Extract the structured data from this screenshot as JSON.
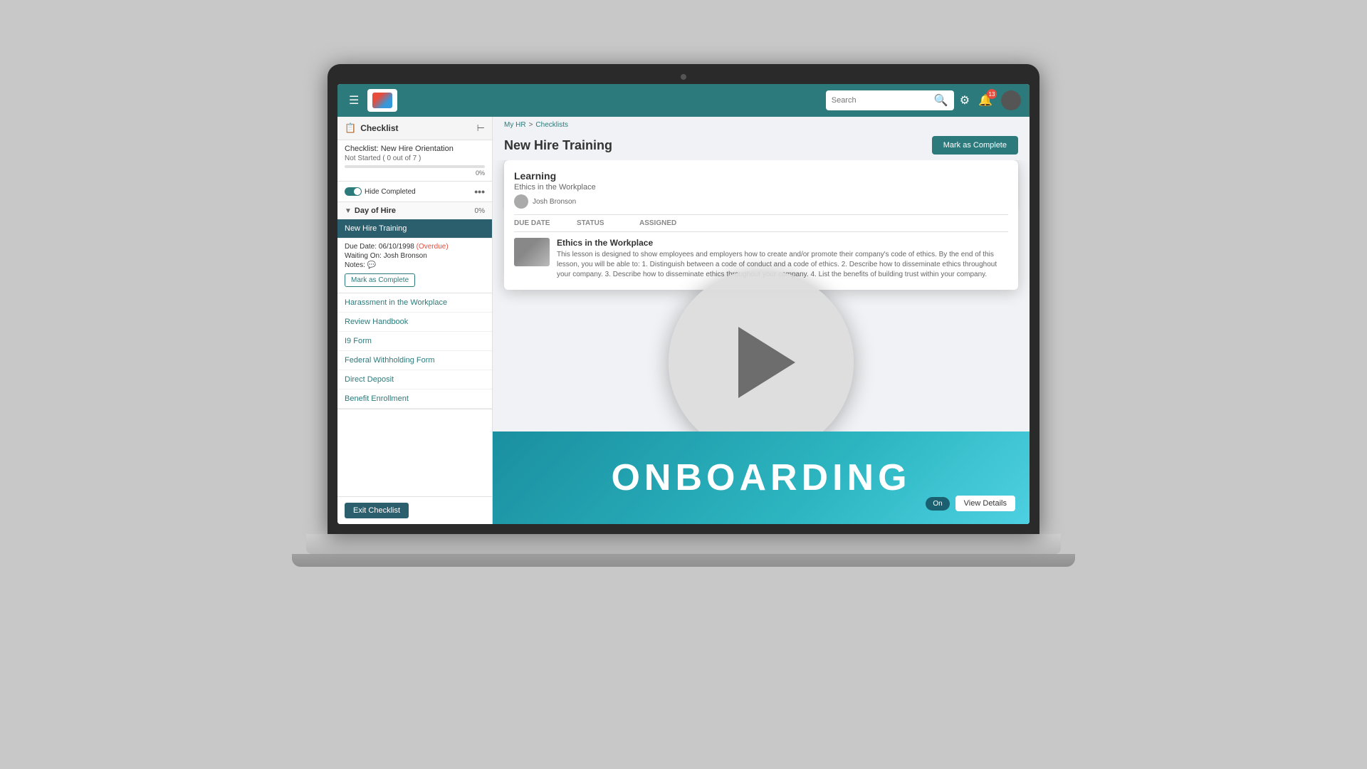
{
  "laptop": {
    "screen": {
      "nav": {
        "hamburger": "☰",
        "search_placeholder": "Search",
        "settings_icon": "⚙",
        "bell_icon": "🔔",
        "badge_count": "13"
      },
      "sidebar": {
        "title": "Checklist",
        "collapse_icon": "⊢",
        "checklist_name": "Checklist: New Hire Orientation",
        "status": "Not Started ( 0 out of 7 )",
        "progress_pct": 0,
        "progress_label": "0%",
        "hide_completed": "Hide Completed",
        "more_icon": "•••",
        "sections": [
          {
            "name": "Day of Hire",
            "percent": "0%",
            "expanded": true,
            "items": [
              {
                "name": "New Hire Training",
                "active": true,
                "due": "Due Date: 06/10/1998",
                "overdue": "(Overdue)",
                "waiting": "Waiting On: Josh Bronson",
                "notes_label": "Notes:",
                "mark_complete": "Mark as Complete"
              },
              {
                "name": "Harassment in the Workplace",
                "active": false
              },
              {
                "name": "Review Handbook",
                "active": false
              },
              {
                "name": "I9 Form",
                "active": false
              },
              {
                "name": "Federal Withholding Form",
                "active": false
              },
              {
                "name": "Direct Deposit",
                "active": false
              },
              {
                "name": "Benefit Enrollment",
                "active": false
              }
            ]
          }
        ]
      },
      "breadcrumb": {
        "my_hr": "My HR",
        "separator": ">",
        "checklists": "Checklists"
      },
      "main": {
        "title": "New Hire Training",
        "mark_complete_btn": "Mark as Complete",
        "learning_card": {
          "category": "Learning",
          "course": "Ethics in the Workplace",
          "author": "Josh Bronson",
          "due": "Due Date -"
        },
        "detail_panel": {
          "title": "Learning",
          "subtitle": "Ethics in the Workplace",
          "author": "Josh Bronson",
          "col_due": "Due Date",
          "col_status": "Status",
          "col_assigned": "Assigned",
          "lesson_title": "Ethics in the Workplace",
          "lesson_desc": "This lesson is designed to show employees and employers how to create and/or promote their company's code of ethics. By the end of this lesson, you will be able to: 1. Distinguish between a code of conduct and a code of ethics. 2. Describe how to disseminate ethics throughout your company. 3. Describe how to disseminate ethics throughout your company. 4. List the benefits of building trust within your company.",
          "play_icon": "▶"
        },
        "onboarding": {
          "text": "ONBOARDING",
          "view_details": "View Details",
          "toggle_label": "On"
        }
      },
      "footer": {
        "exit_btn": "Exit Checklist"
      }
    }
  }
}
